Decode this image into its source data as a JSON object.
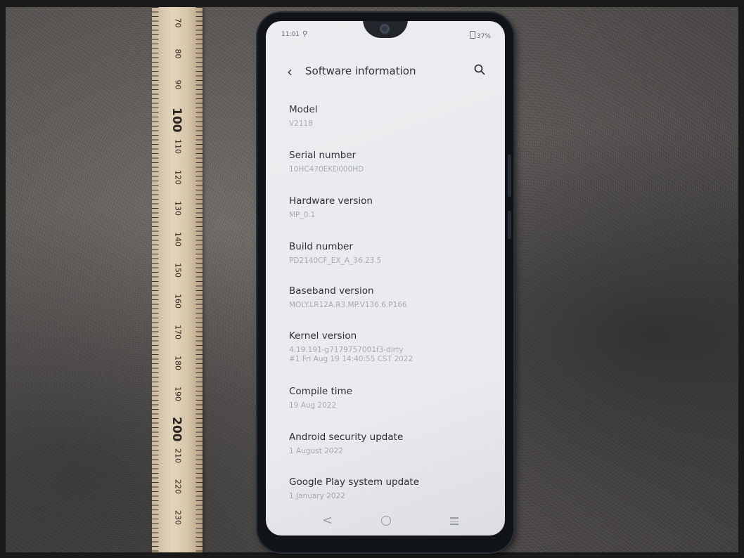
{
  "ruler": {
    "marks": [
      "70",
      "80",
      "90",
      "100",
      "110",
      "120",
      "130",
      "140",
      "150",
      "160",
      "170",
      "180",
      "190",
      "200",
      "210",
      "220",
      "230"
    ]
  },
  "status_bar": {
    "time": "11:01",
    "battery": "37%"
  },
  "header": {
    "title": "Software information",
    "back_icon": "chevron-left-icon",
    "search_icon": "search-icon"
  },
  "items": [
    {
      "label": "Model",
      "value": "V2118"
    },
    {
      "label": "Serial number",
      "value": "10HC470EKD000HD"
    },
    {
      "label": "Hardware version",
      "value": "MP_0.1"
    },
    {
      "label": "Build number",
      "value": "PD2140CF_EX_A_36.23.5"
    },
    {
      "label": "Baseband version",
      "value": "MOLY.LR12A.R3.MP.V136.6.P166"
    },
    {
      "label": "Kernel version",
      "value": "4.19.191-g7179757001f3-dirty",
      "value2": "#1 Fri Aug 19 14:40:55 CST 2022"
    },
    {
      "label": "Compile time",
      "value": "19 Aug 2022"
    },
    {
      "label": "Android security update",
      "value": "1 August 2022"
    },
    {
      "label": "Google Play system update",
      "value": "1 January 2022"
    }
  ],
  "navbar": {
    "back": "<",
    "home_icon": "home-circle-icon",
    "menu_icon": "menu-icon"
  },
  "colors": {
    "screen_bg": "#e9ebee",
    "label": "#2c2f35",
    "value": "#a6aab2"
  }
}
